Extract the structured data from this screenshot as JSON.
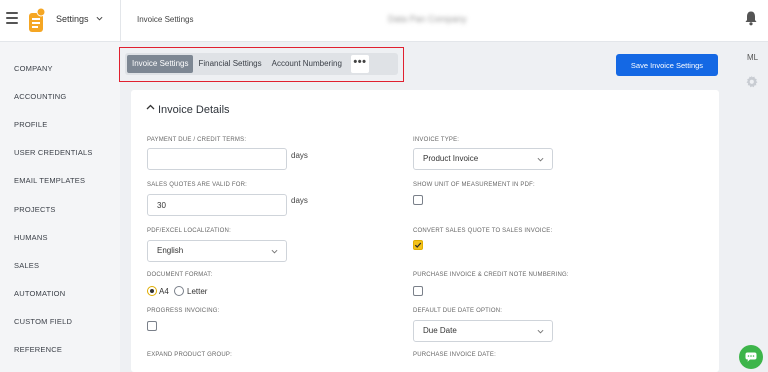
{
  "header": {
    "app_label": "Settings",
    "breadcrumb": "Invoice Settings",
    "company_name": "Data Pan Company"
  },
  "sidebar": {
    "items": [
      {
        "label": "COMPANY"
      },
      {
        "label": "ACCOUNTING"
      },
      {
        "label": "PROFILE"
      },
      {
        "label": "USER CREDENTIALS"
      },
      {
        "label": "EMAIL TEMPLATES"
      },
      {
        "label": "PROJECTS"
      },
      {
        "label": "HUMANS"
      },
      {
        "label": "SALES"
      },
      {
        "label": "AUTOMATION"
      },
      {
        "label": "CUSTOM FIELD"
      },
      {
        "label": "REFERENCE"
      }
    ]
  },
  "right_rail": {
    "user_initials": "ML"
  },
  "tabs": [
    {
      "label": "Invoice Settings",
      "active": true
    },
    {
      "label": "Financial Settings",
      "active": false
    },
    {
      "label": "Account Numbering",
      "active": false
    }
  ],
  "tabs_more_label": "•••",
  "save_button": "Save Invoice Settings",
  "section": {
    "title": "Invoice Details"
  },
  "fields": {
    "payment_due": {
      "label": "PAYMENT DUE / CREDIT TERMS:",
      "value": "",
      "unit": "days"
    },
    "invoice_type": {
      "label": "INVOICE TYPE:",
      "value": "Product Invoice"
    },
    "quotes_valid": {
      "label": "SALES QUOTES ARE VALID FOR:",
      "value": "30",
      "unit": "days"
    },
    "show_unit": {
      "label": "SHOW UNIT OF MEASUREMENT IN PDF:",
      "checked": false
    },
    "localization": {
      "label": "PDF/EXCEL LOCALIZATION:",
      "value": "English"
    },
    "convert_quote": {
      "label": "CONVERT SALES QUOTE TO SALES INVOICE:",
      "checked": true
    },
    "document_format": {
      "label": "DOCUMENT FORMAT:",
      "options": [
        "A4",
        "Letter"
      ],
      "selected": "A4"
    },
    "purchase_numbering": {
      "label": "PURCHASE INVOICE & CREDIT NOTE NUMBERING:",
      "checked": false
    },
    "progress_invoicing": {
      "label": "PROGRESS INVOICING:",
      "checked": false
    },
    "default_due_date": {
      "label": "DEFAULT DUE DATE OPTION:",
      "value": "Due Date"
    },
    "expand_group": {
      "label": "EXPAND PRODUCT GROUP:"
    },
    "purchase_date": {
      "label": "PURCHASE INVOICE DATE:"
    }
  },
  "colors": {
    "accent_blue": "#1468e4",
    "highlight_red": "#e0202f",
    "check_yellow": "#f3c21b",
    "logo_orange": "#f5a623",
    "chat_green": "#3db54a"
  },
  "icons": [
    "menu-icon",
    "app-logo-icon",
    "chevron-down-icon",
    "bell-icon",
    "gear-icon",
    "chevron-up-icon",
    "chat-icon",
    "check-icon"
  ]
}
